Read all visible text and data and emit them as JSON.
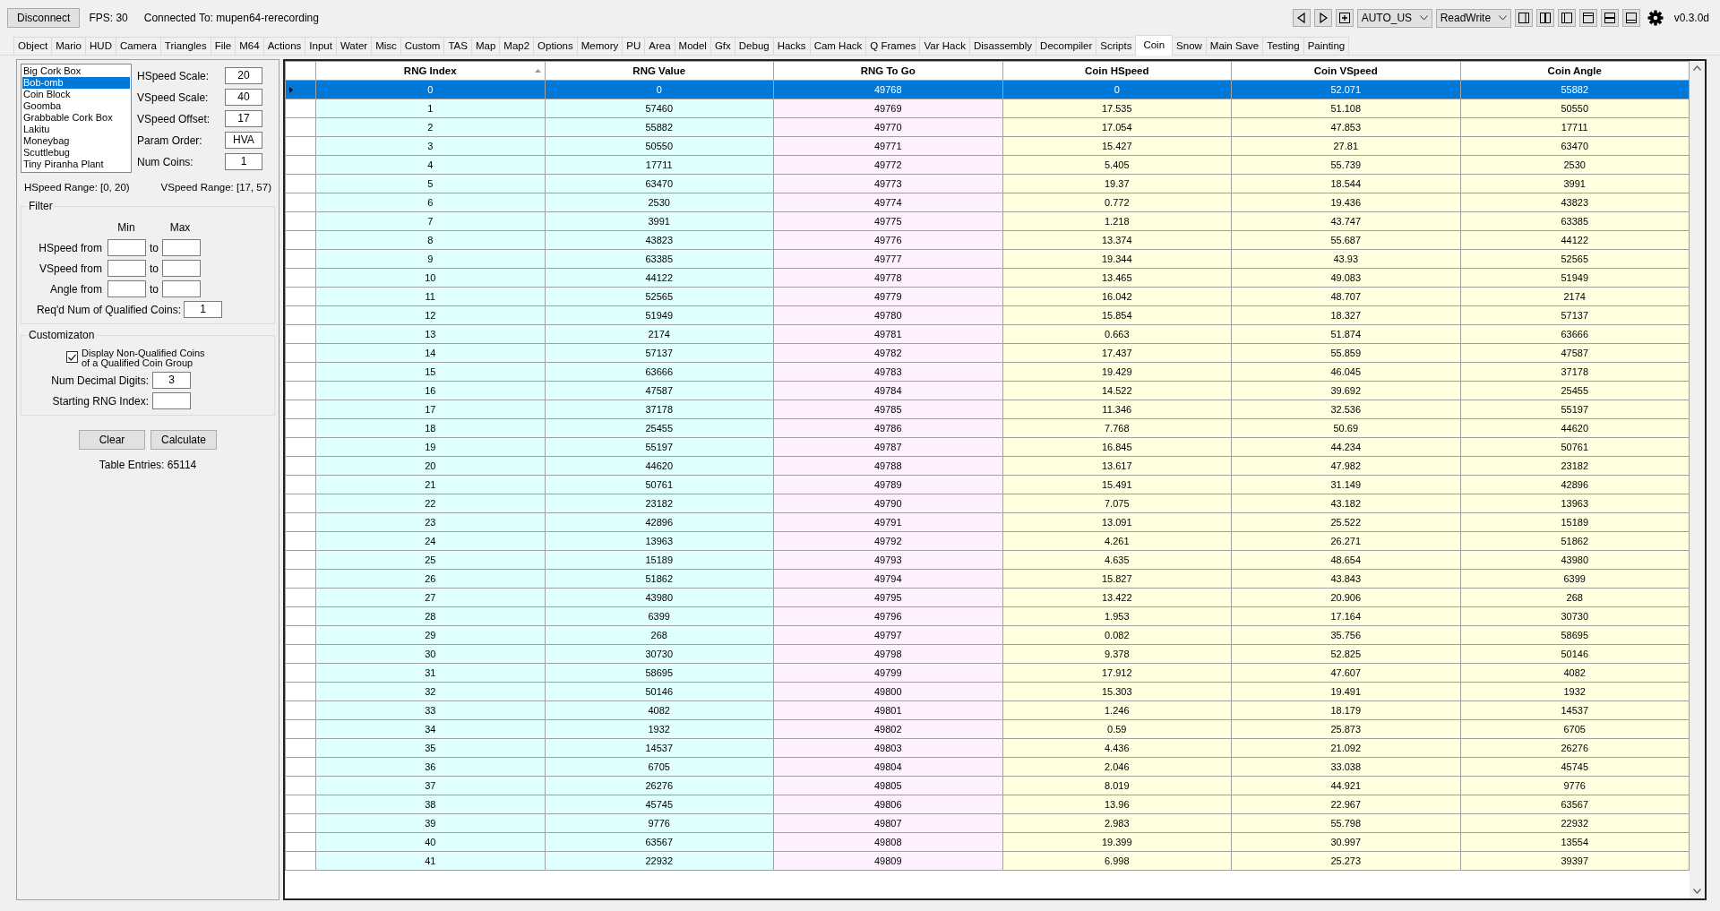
{
  "toolbar": {
    "disconnect_button": "Disconnect",
    "fps": "FPS: 30",
    "connection": "Connected To: mupen64-rerecording",
    "region_select": "AUTO_US",
    "access_select": "ReadWrite",
    "version": "v0.3.0d"
  },
  "tabs": [
    {
      "label": "Object",
      "selected": false
    },
    {
      "label": "Mario",
      "selected": false
    },
    {
      "label": "HUD",
      "selected": false
    },
    {
      "label": "Camera",
      "selected": false
    },
    {
      "label": "Triangles",
      "selected": false
    },
    {
      "label": "File",
      "selected": false
    },
    {
      "label": "M64",
      "selected": false
    },
    {
      "label": "Actions",
      "selected": false
    },
    {
      "label": "Input",
      "selected": false
    },
    {
      "label": "Water",
      "selected": false
    },
    {
      "label": "Misc",
      "selected": false
    },
    {
      "label": "Custom",
      "selected": false
    },
    {
      "label": "TAS",
      "selected": false
    },
    {
      "label": "Map",
      "selected": false
    },
    {
      "label": "Map2",
      "selected": false
    },
    {
      "label": "Options",
      "selected": false
    },
    {
      "label": "Memory",
      "selected": false
    },
    {
      "label": "PU",
      "selected": false
    },
    {
      "label": "Area",
      "selected": false
    },
    {
      "label": "Model",
      "selected": false
    },
    {
      "label": "Gfx",
      "selected": false
    },
    {
      "label": "Debug",
      "selected": false
    },
    {
      "label": "Hacks",
      "selected": false
    },
    {
      "label": "Cam Hack",
      "selected": false
    },
    {
      "label": "Q Frames",
      "selected": false
    },
    {
      "label": "Var Hack",
      "selected": false
    },
    {
      "label": "Disassembly",
      "selected": false
    },
    {
      "label": "Decompiler",
      "selected": false
    },
    {
      "label": "Scripts",
      "selected": false
    },
    {
      "label": "Coin",
      "selected": true
    },
    {
      "label": "Snow",
      "selected": false
    },
    {
      "label": "Main Save",
      "selected": false
    },
    {
      "label": "Testing",
      "selected": false
    },
    {
      "label": "Painting",
      "selected": false
    }
  ],
  "coin_objects": [
    {
      "label": "Big Cork Box",
      "selected": false
    },
    {
      "label": "Bob-omb",
      "selected": true
    },
    {
      "label": "Coin Block",
      "selected": false
    },
    {
      "label": "Goomba",
      "selected": false
    },
    {
      "label": "Grabbable Cork Box",
      "selected": false
    },
    {
      "label": "Lakitu",
      "selected": false
    },
    {
      "label": "Moneybag",
      "selected": false
    },
    {
      "label": "Scuttlebug",
      "selected": false
    },
    {
      "label": "Tiny Piranha Plant",
      "selected": false
    }
  ],
  "params": [
    {
      "label": "HSpeed Scale:",
      "value": "20"
    },
    {
      "label": "VSpeed Scale:",
      "value": "40"
    },
    {
      "label": "VSpeed Offset:",
      "value": "17"
    },
    {
      "label": "Param Order:",
      "value": "HVA"
    },
    {
      "label": "Num Coins:",
      "value": "1"
    }
  ],
  "hspeed_range": "HSpeed Range: [0, 20)",
  "vspeed_range": "VSpeed Range: [17, 57)",
  "filter": {
    "title": "Filter",
    "min_label": "Min",
    "max_label": "Max",
    "rows": [
      {
        "label": "HSpeed from",
        "to": "to"
      },
      {
        "label": "VSpeed from",
        "to": "to"
      },
      {
        "label": "Angle from",
        "to": "to"
      }
    ],
    "required_label": "Req'd Num of Qualified Coins:",
    "required_value": "1"
  },
  "customization": {
    "title": "Customizaton",
    "display_non_qualified": {
      "label_line_1": "Display Non-Qualified Coins",
      "label_line_2": "of a Qualified Coin Group",
      "checked": true
    },
    "decimal_label": "Num Decimal Digits:",
    "decimal_value": "3",
    "starting_label": "Starting RNG Index:"
  },
  "buttons": [
    "Clear",
    "Calculate"
  ],
  "table_entries": "Table Entries: 65114",
  "table": {
    "columns": [
      "RNG Index",
      "RNG Value",
      "RNG To Go",
      "Coin HSpeed",
      "Coin VSpeed",
      "Coin Angle"
    ],
    "rows": [
      {
        "cells": [
          "0",
          "0",
          "49768",
          "0",
          "52.071",
          "55882"
        ],
        "selected": true
      },
      {
        "cells": [
          "1",
          "57460",
          "49769",
          "17.535",
          "51.108",
          "50550"
        ],
        "selected": false
      },
      {
        "cells": [
          "2",
          "55882",
          "49770",
          "17.054",
          "47.853",
          "17711"
        ],
        "selected": false
      },
      {
        "cells": [
          "3",
          "50550",
          "49771",
          "15.427",
          "27.81",
          "63470"
        ],
        "selected": false
      },
      {
        "cells": [
          "4",
          "17711",
          "49772",
          "5.405",
          "55.739",
          "2530"
        ],
        "selected": false
      },
      {
        "cells": [
          "5",
          "63470",
          "49773",
          "19.37",
          "18.544",
          "3991"
        ],
        "selected": false
      },
      {
        "cells": [
          "6",
          "2530",
          "49774",
          "0.772",
          "19.436",
          "43823"
        ],
        "selected": false
      },
      {
        "cells": [
          "7",
          "3991",
          "49775",
          "1.218",
          "43.747",
          "63385"
        ],
        "selected": false
      },
      {
        "cells": [
          "8",
          "43823",
          "49776",
          "13.374",
          "55.687",
          "44122"
        ],
        "selected": false
      },
      {
        "cells": [
          "9",
          "63385",
          "49777",
          "19.344",
          "43.93",
          "52565"
        ],
        "selected": false
      },
      {
        "cells": [
          "10",
          "44122",
          "49778",
          "13.465",
          "49.083",
          "51949"
        ],
        "selected": false
      },
      {
        "cells": [
          "11",
          "52565",
          "49779",
          "16.042",
          "48.707",
          "2174"
        ],
        "selected": false
      },
      {
        "cells": [
          "12",
          "51949",
          "49780",
          "15.854",
          "18.327",
          "57137"
        ],
        "selected": false
      },
      {
        "cells": [
          "13",
          "2174",
          "49781",
          "0.663",
          "51.874",
          "63666"
        ],
        "selected": false
      },
      {
        "cells": [
          "14",
          "57137",
          "49782",
          "17.437",
          "55.859",
          "47587"
        ],
        "selected": false
      },
      {
        "cells": [
          "15",
          "63666",
          "49783",
          "19.429",
          "46.045",
          "37178"
        ],
        "selected": false
      },
      {
        "cells": [
          "16",
          "47587",
          "49784",
          "14.522",
          "39.692",
          "25455"
        ],
        "selected": false
      },
      {
        "cells": [
          "17",
          "37178",
          "49785",
          "11.346",
          "32.536",
          "55197"
        ],
        "selected": false
      },
      {
        "cells": [
          "18",
          "25455",
          "49786",
          "7.768",
          "50.69",
          "44620"
        ],
        "selected": false
      },
      {
        "cells": [
          "19",
          "55197",
          "49787",
          "16.845",
          "44.234",
          "50761"
        ],
        "selected": false
      },
      {
        "cells": [
          "20",
          "44620",
          "49788",
          "13.617",
          "47.982",
          "23182"
        ],
        "selected": false
      },
      {
        "cells": [
          "21",
          "50761",
          "49789",
          "15.491",
          "31.149",
          "42896"
        ],
        "selected": false
      },
      {
        "cells": [
          "22",
          "23182",
          "49790",
          "7.075",
          "43.182",
          "13963"
        ],
        "selected": false
      },
      {
        "cells": [
          "23",
          "42896",
          "49791",
          "13.091",
          "25.522",
          "15189"
        ],
        "selected": false
      },
      {
        "cells": [
          "24",
          "13963",
          "49792",
          "4.261",
          "26.271",
          "51862"
        ],
        "selected": false
      },
      {
        "cells": [
          "25",
          "15189",
          "49793",
          "4.635",
          "48.654",
          "43980"
        ],
        "selected": false
      },
      {
        "cells": [
          "26",
          "51862",
          "49794",
          "15.827",
          "43.843",
          "6399"
        ],
        "selected": false
      },
      {
        "cells": [
          "27",
          "43980",
          "49795",
          "13.422",
          "20.906",
          "268"
        ],
        "selected": false
      },
      {
        "cells": [
          "28",
          "6399",
          "49796",
          "1.953",
          "17.164",
          "30730"
        ],
        "selected": false
      },
      {
        "cells": [
          "29",
          "268",
          "49797",
          "0.082",
          "35.756",
          "58695"
        ],
        "selected": false
      },
      {
        "cells": [
          "30",
          "30730",
          "49798",
          "9.378",
          "52.825",
          "50146"
        ],
        "selected": false
      },
      {
        "cells": [
          "31",
          "58695",
          "49799",
          "17.912",
          "47.607",
          "4082"
        ],
        "selected": false
      },
      {
        "cells": [
          "32",
          "50146",
          "49800",
          "15.303",
          "19.491",
          "1932"
        ],
        "selected": false
      },
      {
        "cells": [
          "33",
          "4082",
          "49801",
          "1.246",
          "18.179",
          "14537"
        ],
        "selected": false
      },
      {
        "cells": [
          "34",
          "1932",
          "49802",
          "0.59",
          "25.873",
          "6705"
        ],
        "selected": false
      },
      {
        "cells": [
          "35",
          "14537",
          "49803",
          "4.436",
          "21.092",
          "26276"
        ],
        "selected": false
      },
      {
        "cells": [
          "36",
          "6705",
          "49804",
          "2.046",
          "33.038",
          "45745"
        ],
        "selected": false
      },
      {
        "cells": [
          "37",
          "26276",
          "49805",
          "8.019",
          "44.921",
          "9776"
        ],
        "selected": false
      },
      {
        "cells": [
          "38",
          "45745",
          "49806",
          "13.96",
          "22.967",
          "63567"
        ],
        "selected": false
      },
      {
        "cells": [
          "39",
          "9776",
          "49807",
          "2.983",
          "55.798",
          "22932"
        ],
        "selected": false
      },
      {
        "cells": [
          "40",
          "63567",
          "49808",
          "19.399",
          "30.997",
          "13554"
        ],
        "selected": false
      },
      {
        "cells": [
          "41",
          "22932",
          "49809",
          "6.998",
          "25.273",
          "39397"
        ],
        "selected": false
      }
    ]
  }
}
